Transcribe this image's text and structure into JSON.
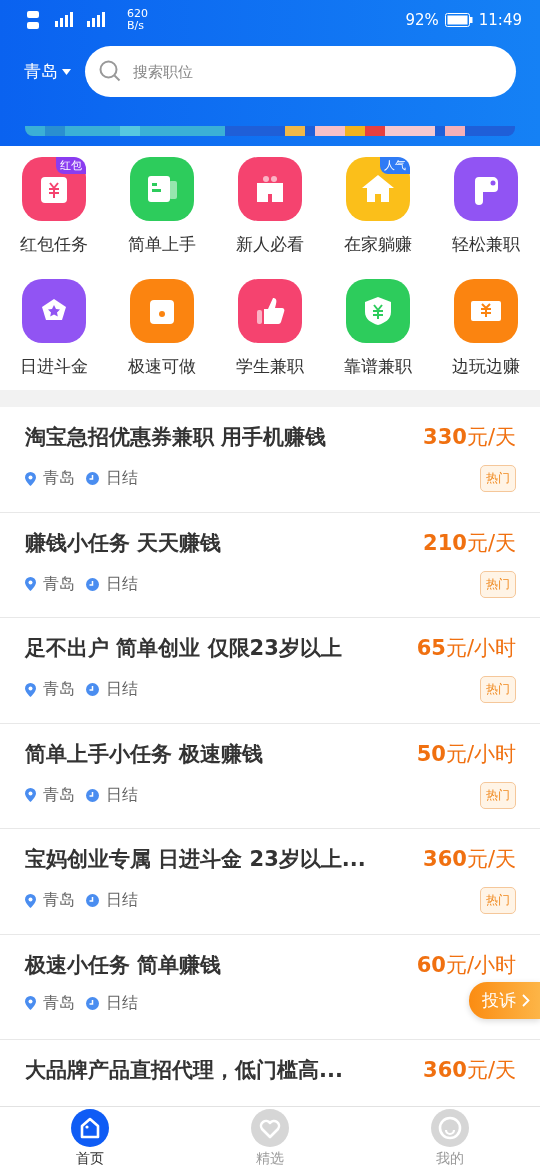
{
  "status_bar": {
    "net_speed": "620",
    "net_unit": "B/s",
    "battery": "92%",
    "time": "11:49"
  },
  "header": {
    "city": "青岛",
    "search": {
      "placeholder": "搜索职位"
    }
  },
  "shortcuts": [
    {
      "label": "红包任务",
      "color": "#f5436f",
      "badge": {
        "text": "红包",
        "color": "#8a3cf0"
      }
    },
    {
      "label": "简单上手",
      "color": "#2dcc5c"
    },
    {
      "label": "新人必看",
      "color": "#f5436f"
    },
    {
      "label": "在家躺赚",
      "color": "#fbbf1a",
      "badge": {
        "text": "人气",
        "color": "#2f7bf5"
      }
    },
    {
      "label": "轻松兼职",
      "color": "#9154f3"
    },
    {
      "label": "日进斗金",
      "color": "#9154f3"
    },
    {
      "label": "极速可做",
      "color": "#fb8410"
    },
    {
      "label": "学生兼职",
      "color": "#f5436f"
    },
    {
      "label": "靠谱兼职",
      "color": "#2dcc5c"
    },
    {
      "label": "边玩边赚",
      "color": "#fb8410"
    }
  ],
  "jobs": [
    {
      "title": "淘宝急招优惠券兼职 用手机赚钱",
      "amount": "330",
      "unit": "元/天",
      "city": "青岛",
      "settle": "日结",
      "tag": "热门"
    },
    {
      "title": "赚钱小任务 天天赚钱",
      "amount": "210",
      "unit": "元/天",
      "city": "青岛",
      "settle": "日结",
      "tag": "热门"
    },
    {
      "title": "足不出户 简单创业 仅限23岁以上",
      "amount": "65",
      "unit": "元/小时",
      "city": "青岛",
      "settle": "日结",
      "tag": "热门"
    },
    {
      "title": "简单上手小任务 极速赚钱",
      "amount": "50",
      "unit": "元/小时",
      "city": "青岛",
      "settle": "日结",
      "tag": "热门"
    },
    {
      "title": "宝妈创业专属 日进斗金 23岁以上...",
      "amount": "360",
      "unit": "元/天",
      "city": "青岛",
      "settle": "日结",
      "tag": "热门"
    },
    {
      "title": "极速小任务  简单赚钱",
      "amount": "60",
      "unit": "元/小时",
      "city": "青岛",
      "settle": "日结"
    },
    {
      "title": "大品牌产品直招代理，低门槛高...",
      "amount": "360",
      "unit": "元/天"
    }
  ],
  "complaint_button": {
    "label": "投诉"
  },
  "tab_bar": [
    {
      "label": "首页",
      "selected": true
    },
    {
      "label": "精选",
      "selected": false
    },
    {
      "label": "我的",
      "selected": false
    }
  ]
}
